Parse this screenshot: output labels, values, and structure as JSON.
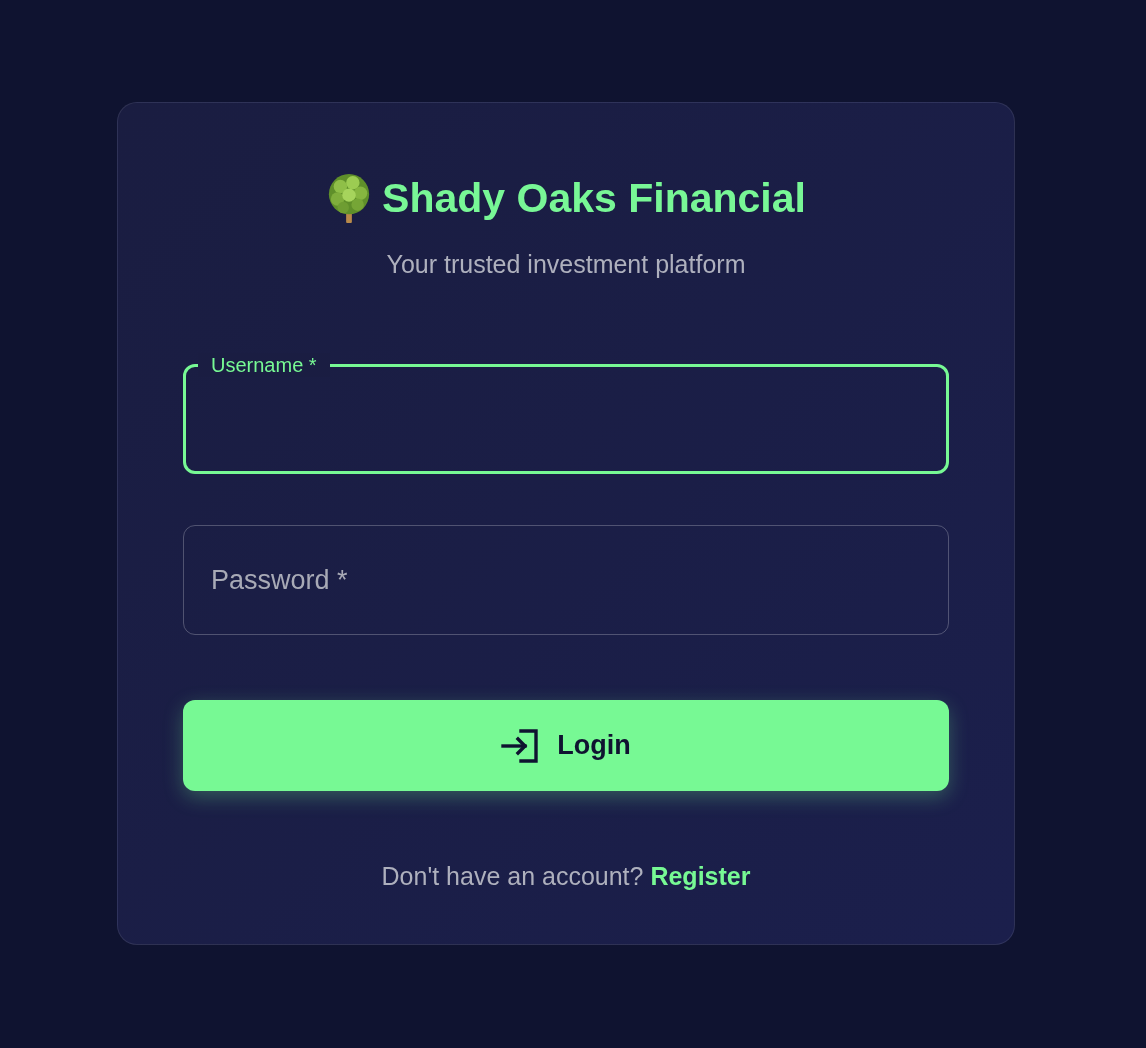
{
  "brand": {
    "title": "Shady Oaks Financial",
    "tagline": "Your trusted investment platform"
  },
  "fields": [
    {
      "label": "Username *",
      "focused": true
    },
    {
      "label": "Password *",
      "focused": false
    }
  ],
  "login_button": {
    "label": "Login"
  },
  "register_prompt": {
    "text": "Don't have an account?",
    "link": "Register"
  }
}
